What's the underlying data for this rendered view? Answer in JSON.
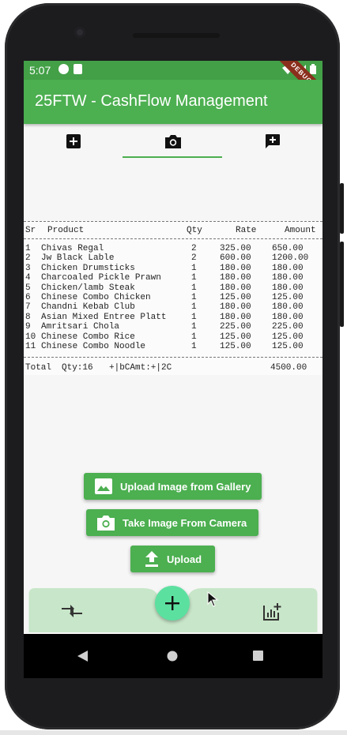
{
  "status_bar": {
    "time": "5:07",
    "debug_banner": "DEBUG"
  },
  "app_bar": {
    "title": "25FTW - CashFlow Management"
  },
  "tabs": [
    {
      "icon": "add-box-icon",
      "selected": false
    },
    {
      "icon": "camera-icon",
      "selected": true
    },
    {
      "icon": "add-comment-icon",
      "selected": false
    }
  ],
  "receipt": {
    "headers": {
      "sr": "Sr",
      "product": "Product",
      "qty": "Qty",
      "rate": "Rate",
      "amount": "Amount"
    },
    "items": [
      {
        "sr": "1",
        "product": "Chivas Regal",
        "qty": "2",
        "rate": "325.00",
        "amount": "650.00"
      },
      {
        "sr": "2",
        "product": "Jw Black Lable",
        "qty": "2",
        "rate": "600.00",
        "amount": "1200.00"
      },
      {
        "sr": "3",
        "product": "Chicken Drumsticks",
        "qty": "1",
        "rate": "180.00",
        "amount": "180.00"
      },
      {
        "sr": "4",
        "product": "Charcoaled Pickle Prawn",
        "qty": "1",
        "rate": "180.00",
        "amount": "180.00"
      },
      {
        "sr": "5",
        "product": "Chicken/lamb Steak",
        "qty": "1",
        "rate": "180.00",
        "amount": "180.00"
      },
      {
        "sr": "6",
        "product": "Chinese Combo Chicken",
        "qty": "1",
        "rate": "125.00",
        "amount": "125.00"
      },
      {
        "sr": "7",
        "product": "Chandni Kebab Club",
        "qty": "1",
        "rate": "180.00",
        "amount": "180.00"
      },
      {
        "sr": "8",
        "product": "Asian Mixed Entree Platt",
        "qty": "1",
        "rate": "180.00",
        "amount": "180.00"
      },
      {
        "sr": "9",
        "product": "Amritsari Chola",
        "qty": "1",
        "rate": "225.00",
        "amount": "225.00"
      },
      {
        "sr": "10",
        "product": "Chinese Combo Rice",
        "qty": "1",
        "rate": "125.00",
        "amount": "125.00"
      },
      {
        "sr": "11",
        "product": "Chinese Combo Noodle",
        "qty": "1",
        "rate": "125.00",
        "amount": "125.00"
      }
    ],
    "total": {
      "label": "Total",
      "qty": "Qty:16",
      "extra": "+|bCAmt:+|2C",
      "amount": "4500.00"
    }
  },
  "buttons": {
    "gallery": "Upload Image from Gallery",
    "camera": "Take Image From Camera",
    "upload": "Upload"
  },
  "bottom_nav": {
    "left_icon": "compare-arrows-icon",
    "fab_icon": "add-icon",
    "right_icon": "add-chart-icon"
  },
  "colors": {
    "primary": "#4caf50",
    "status": "#43a047",
    "fab": "#5ce0a0",
    "bottom_nav": "#c8e6c9"
  }
}
